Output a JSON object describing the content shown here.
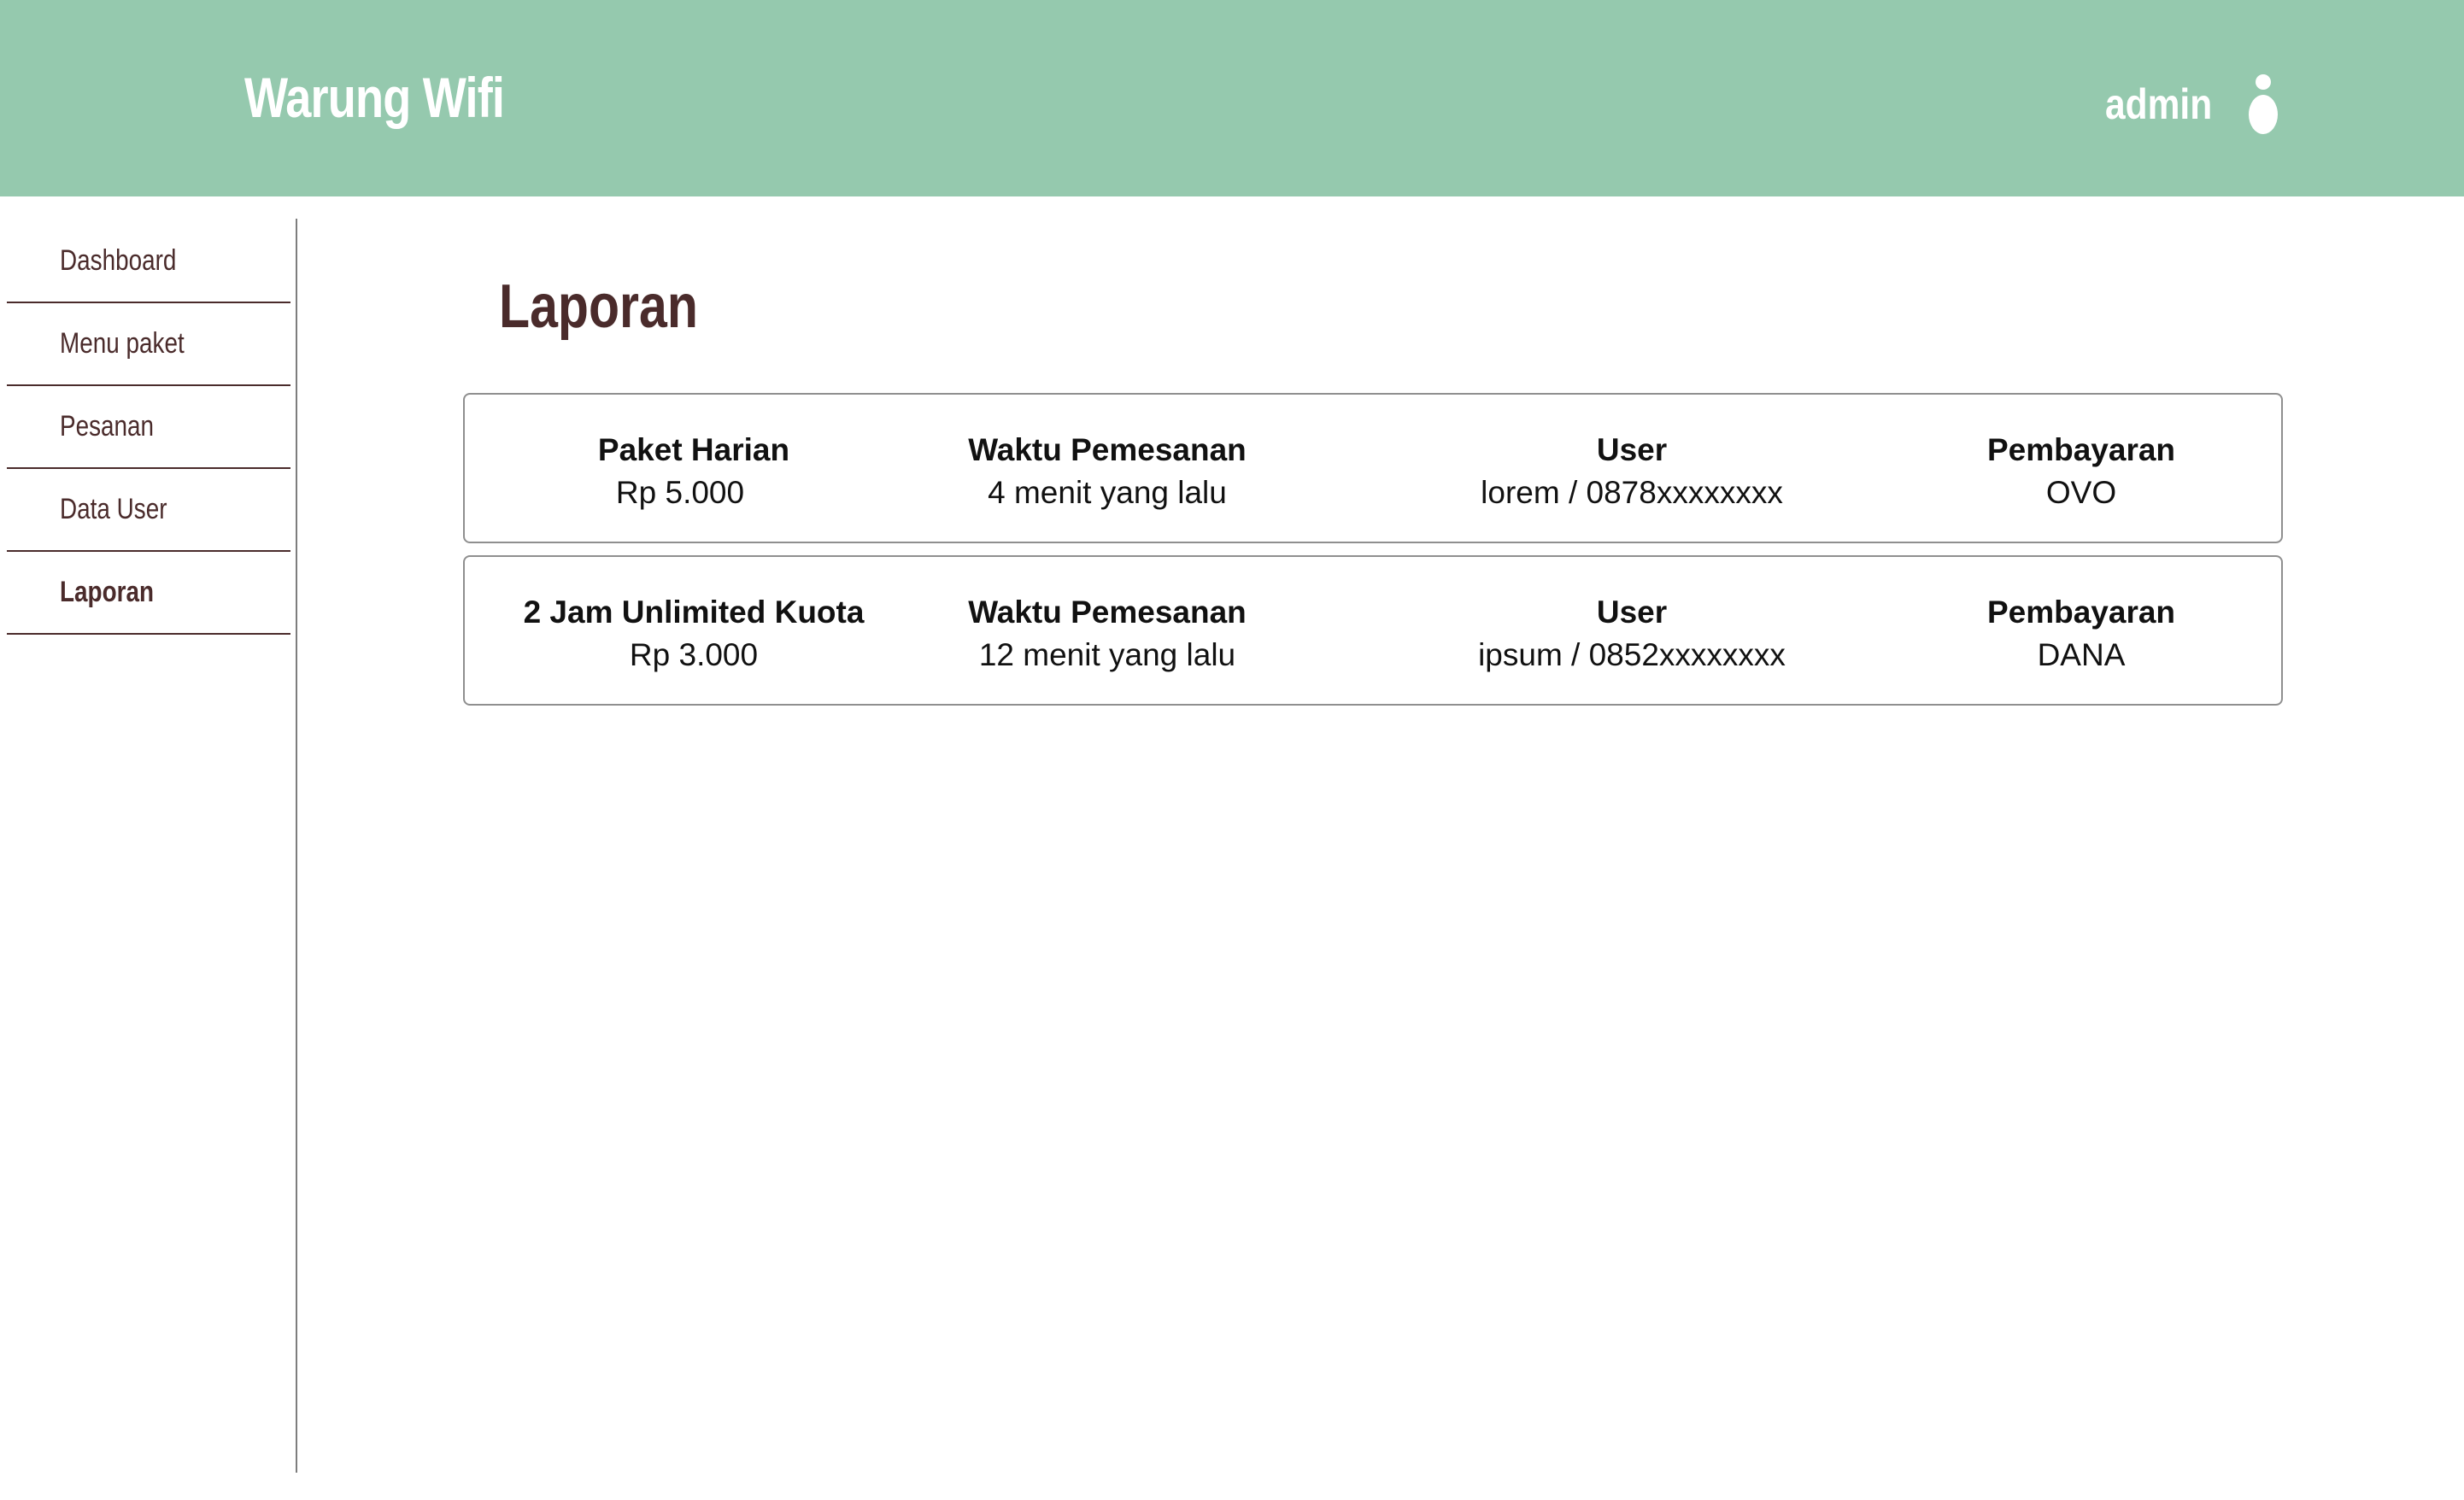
{
  "header": {
    "brand": "Warung Wifi",
    "user_name": "admin",
    "user_icon": "user-icon",
    "bg_color": "#95c9ae"
  },
  "sidebar": {
    "items": [
      {
        "label": "Dashboard",
        "active": false
      },
      {
        "label": "Menu paket",
        "active": false
      },
      {
        "label": "Pesanan",
        "active": false
      },
      {
        "label": "Data User",
        "active": false
      },
      {
        "label": "Laporan",
        "active": true
      }
    ]
  },
  "main": {
    "title": "Laporan",
    "orders": [
      {
        "package": "Paket Harian",
        "price": "Rp 5.000",
        "time_label": "Waktu Pemesanan",
        "time_value": "4 menit yang lalu",
        "user_label": "User",
        "user_value": "lorem / 0878xxxxxxxx",
        "payment_label": "Pembayaran",
        "payment_value": "OVO"
      },
      {
        "package": "2 Jam Unlimited Kuota",
        "price": "Rp 3.000",
        "time_label": "Waktu Pemesanan",
        "time_value": "12 menit yang lalu",
        "user_label": "User",
        "user_value": "ipsum / 0852xxxxxxxx",
        "payment_label": "Pembayaran",
        "payment_value": "DANA"
      }
    ]
  },
  "colors": {
    "accent_text": "#4a2b2b",
    "header_bg": "#95c9ae"
  }
}
